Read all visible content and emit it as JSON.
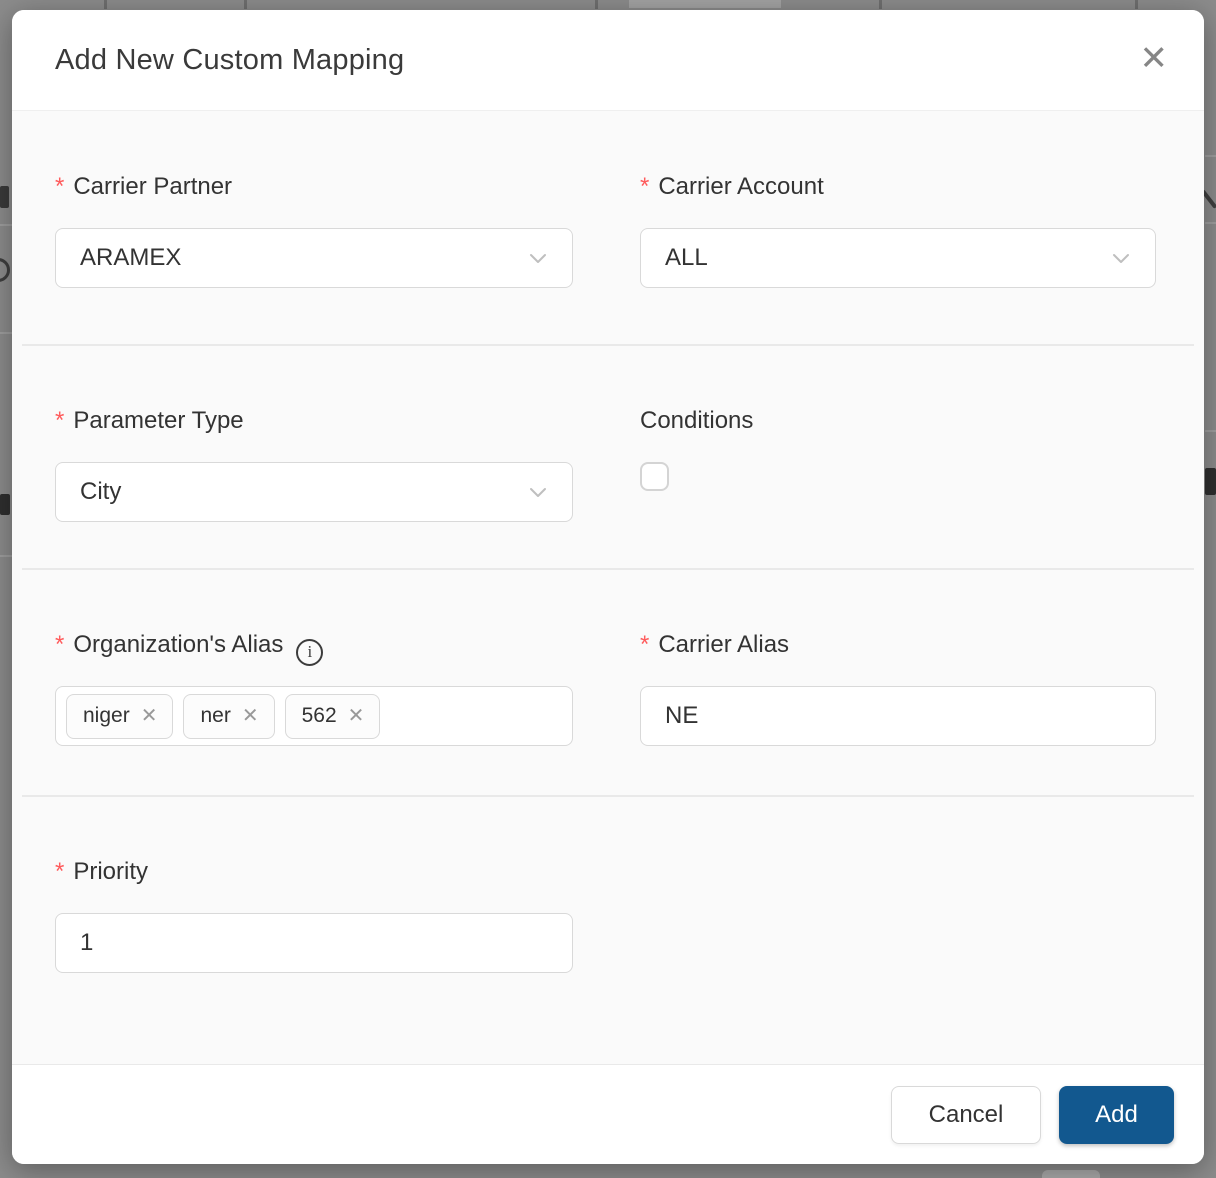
{
  "dialog": {
    "title": "Add New Custom Mapping",
    "close_icon": "✕"
  },
  "fields": {
    "carrier_partner": {
      "required_mark": "*",
      "label": "Carrier Partner",
      "value": "ARAMEX"
    },
    "carrier_account": {
      "required_mark": "*",
      "label": "Carrier Account",
      "value": "ALL"
    },
    "parameter_type": {
      "required_mark": "*",
      "label": "Parameter Type",
      "value": "City"
    },
    "conditions": {
      "label": "Conditions",
      "checked": false
    },
    "organizations_alias": {
      "required_mark": "*",
      "label": "Organization's Alias",
      "info_icon_glyph": "i",
      "tags": [
        {
          "text": "niger",
          "remove_glyph": "✕"
        },
        {
          "text": "ner",
          "remove_glyph": "✕"
        },
        {
          "text": "562",
          "remove_glyph": "✕"
        }
      ]
    },
    "carrier_alias": {
      "required_mark": "*",
      "label": "Carrier Alias",
      "value": "NE"
    },
    "priority": {
      "required_mark": "*",
      "label": "Priority",
      "value": "1"
    }
  },
  "footer": {
    "cancel_label": "Cancel",
    "add_label": "Add"
  },
  "colors": {
    "primary_button": "#12588f",
    "required_asterisk": "#ff5b5c",
    "overlay_backdrop": "#8c8c8c"
  }
}
